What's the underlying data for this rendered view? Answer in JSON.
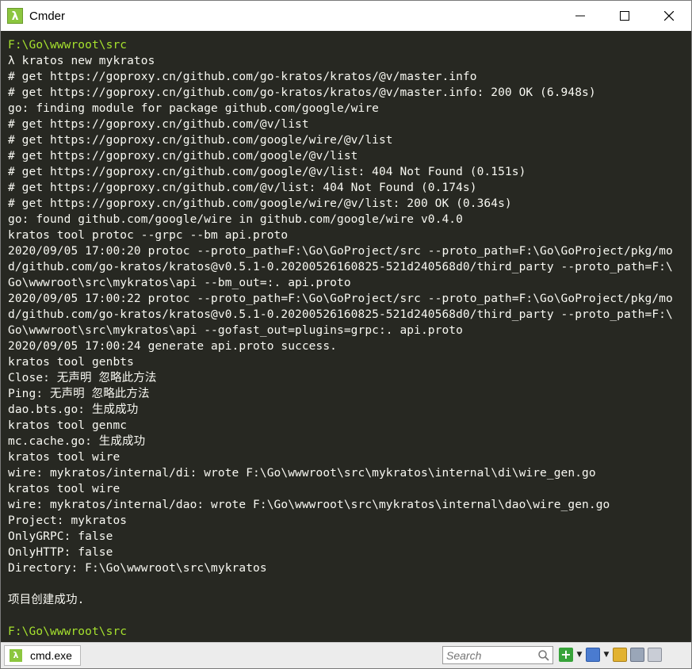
{
  "window": {
    "title": "Cmder",
    "icon": "lambda-icon"
  },
  "controls": {
    "minimize": "—",
    "maximize": "☐",
    "close": "✕"
  },
  "terminal": {
    "prompt_color": "#a6e22e",
    "text_color": "#f8f8f2",
    "background": "#272822",
    "lines": [
      {
        "text": "F:\\Go\\wwwroot\\src",
        "kind": "prompt"
      },
      {
        "text": "λ kratos new mykratos",
        "kind": "command"
      },
      {
        "text": "# get https://goproxy.cn/github.com/go-kratos/kratos/@v/master.info",
        "kind": "output"
      },
      {
        "text": "# get https://goproxy.cn/github.com/go-kratos/kratos/@v/master.info: 200 OK (6.948s)",
        "kind": "output"
      },
      {
        "text": "go: finding module for package github.com/google/wire",
        "kind": "output"
      },
      {
        "text": "# get https://goproxy.cn/github.com/@v/list",
        "kind": "output"
      },
      {
        "text": "# get https://goproxy.cn/github.com/google/wire/@v/list",
        "kind": "output"
      },
      {
        "text": "# get https://goproxy.cn/github.com/google/@v/list",
        "kind": "output"
      },
      {
        "text": "# get https://goproxy.cn/github.com/google/@v/list: 404 Not Found (0.151s)",
        "kind": "output"
      },
      {
        "text": "# get https://goproxy.cn/github.com/@v/list: 404 Not Found (0.174s)",
        "kind": "output"
      },
      {
        "text": "# get https://goproxy.cn/github.com/google/wire/@v/list: 200 OK (0.364s)",
        "kind": "output"
      },
      {
        "text": "go: found github.com/google/wire in github.com/google/wire v0.4.0",
        "kind": "output"
      },
      {
        "text": "kratos tool protoc --grpc --bm api.proto",
        "kind": "output"
      },
      {
        "text": "2020/09/05 17:00:20 protoc --proto_path=F:\\Go\\GoProject/src --proto_path=F:\\Go\\GoProject/pkg/mo",
        "kind": "output"
      },
      {
        "text": "d/github.com/go-kratos/kratos@v0.5.1-0.20200526160825-521d240568d0/third_party --proto_path=F:\\",
        "kind": "output"
      },
      {
        "text": "Go\\wwwroot\\src\\mykratos\\api --bm_out=:. api.proto",
        "kind": "output"
      },
      {
        "text": "2020/09/05 17:00:22 protoc --proto_path=F:\\Go\\GoProject/src --proto_path=F:\\Go\\GoProject/pkg/mo",
        "kind": "output"
      },
      {
        "text": "d/github.com/go-kratos/kratos@v0.5.1-0.20200526160825-521d240568d0/third_party --proto_path=F:\\",
        "kind": "output"
      },
      {
        "text": "Go\\wwwroot\\src\\mykratos\\api --gofast_out=plugins=grpc:. api.proto",
        "kind": "output"
      },
      {
        "text": "2020/09/05 17:00:24 generate api.proto success.",
        "kind": "output"
      },
      {
        "text": "kratos tool genbts",
        "kind": "output"
      },
      {
        "text": "Close: 无声明 忽略此方法",
        "kind": "output"
      },
      {
        "text": "Ping: 无声明 忽略此方法",
        "kind": "output"
      },
      {
        "text": "dao.bts.go: 生成成功",
        "kind": "output"
      },
      {
        "text": "kratos tool genmc",
        "kind": "output"
      },
      {
        "text": "mc.cache.go: 生成成功",
        "kind": "output"
      },
      {
        "text": "kratos tool wire",
        "kind": "output"
      },
      {
        "text": "wire: mykratos/internal/di: wrote F:\\Go\\wwwroot\\src\\mykratos\\internal\\di\\wire_gen.go",
        "kind": "output"
      },
      {
        "text": "kratos tool wire",
        "kind": "output"
      },
      {
        "text": "wire: mykratos/internal/dao: wrote F:\\Go\\wwwroot\\src\\mykratos\\internal\\dao\\wire_gen.go",
        "kind": "output"
      },
      {
        "text": "Project: mykratos",
        "kind": "output"
      },
      {
        "text": "OnlyGRPC: false",
        "kind": "output"
      },
      {
        "text": "OnlyHTTP: false",
        "kind": "output"
      },
      {
        "text": "Directory: F:\\Go\\wwwroot\\src\\mykratos",
        "kind": "output"
      },
      {
        "text": "",
        "kind": "blank"
      },
      {
        "text": "项目创建成功.",
        "kind": "output"
      },
      {
        "text": "",
        "kind": "blank"
      },
      {
        "text": "F:\\Go\\wwwroot\\src",
        "kind": "prompt"
      }
    ]
  },
  "statusbar": {
    "tab_label": "cmd.exe",
    "search_placeholder": "Search",
    "icons": [
      "search-icon",
      "new-console-icon",
      "dropdown-icon",
      "window-icon",
      "dropdown-icon",
      "lock-icon",
      "menu-icon",
      "grid-icon"
    ]
  }
}
